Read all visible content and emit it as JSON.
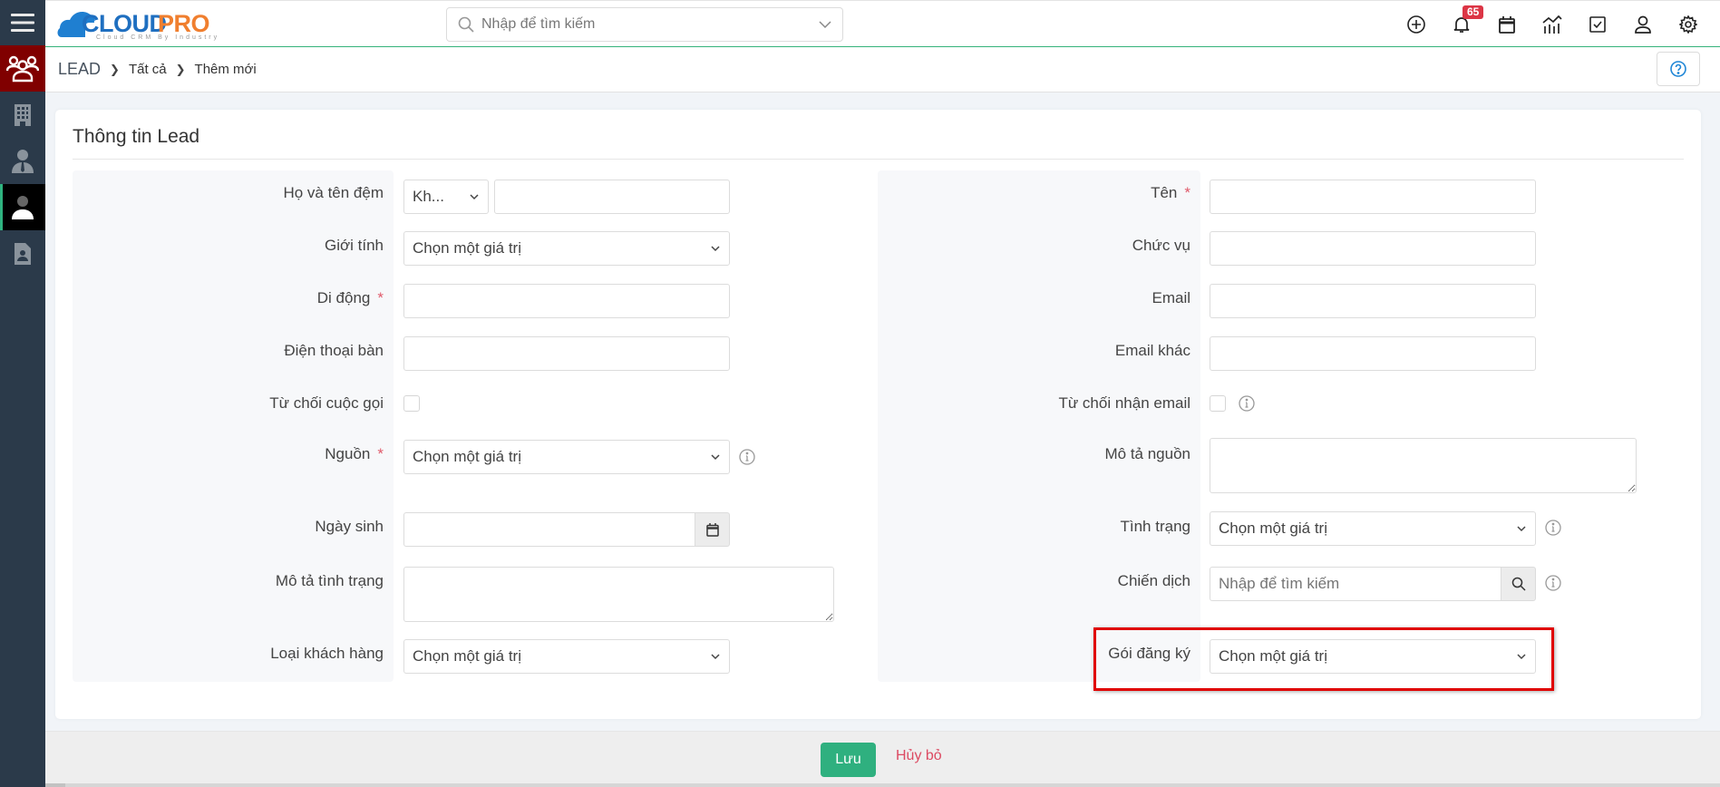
{
  "header": {
    "logo_text_main": "CLOUD",
    "logo_text_accent": "PRO",
    "logo_tagline": "Cloud CRM By Industry",
    "search_placeholder": "Nhập để tìm kiếm",
    "notification_count": "65",
    "icons": [
      "plus-circle-icon",
      "bell-icon",
      "calendar-icon",
      "chart-icon",
      "checkbox-icon",
      "user-icon",
      "gear-icon"
    ]
  },
  "sidebar": {
    "items": [
      {
        "name": "leads",
        "icon": "people-group-icon"
      },
      {
        "name": "organizations",
        "icon": "building-icon"
      },
      {
        "name": "contacts",
        "icon": "businessman-icon"
      },
      {
        "name": "leads-active",
        "icon": "person-icon"
      },
      {
        "name": "contact-card",
        "icon": "contact-card-icon"
      }
    ]
  },
  "breadcrumb": {
    "root": "LEAD",
    "items": [
      "Tất cả",
      "Thêm mới"
    ]
  },
  "card": {
    "title": "Thông tin Lead"
  },
  "form": {
    "left": {
      "full_name_label": "Họ và tên đệm",
      "salutation_value": "Kh...",
      "full_name_value": "",
      "gender_label": "Giới tính",
      "gender_value": "Chọn một giá trị",
      "mobile_label": "Di động",
      "mobile_value": "",
      "phone_label": "Điện thoại bàn",
      "phone_value": "",
      "reject_call_label": "Từ chối cuộc gọi",
      "source_label": "Nguồn",
      "source_value": "Chọn một giá trị",
      "birthday_label": "Ngày sinh",
      "birthday_value": "",
      "status_desc_label": "Mô tả tình trạng",
      "customer_type_label": "Loại khách hàng",
      "customer_type_value": "Chọn một giá trị"
    },
    "right": {
      "first_name_label": "Tên",
      "first_name_value": "",
      "title_label": "Chức vụ",
      "title_value": "",
      "email_label": "Email",
      "email_value": "",
      "email_other_label": "Email khác",
      "email_other_value": "",
      "reject_email_label": "Từ chối nhận email",
      "source_desc_label": "Mô tả nguồn",
      "status_label": "Tình trạng",
      "status_value": "Chọn một giá trị",
      "campaign_label": "Chiến dịch",
      "campaign_placeholder": "Nhập để tìm kiếm",
      "package_label": "Gói đăng ký",
      "package_value": "Chọn một giá trị"
    },
    "required_mark": "*"
  },
  "footer": {
    "save_label": "Lưu",
    "cancel_label": "Hủy bỏ"
  },
  "colors": {
    "sidebar_bg": "#2b3a4a",
    "leads_module": "#800000",
    "accent_green": "#2fb07f",
    "danger": "#dc4a62",
    "highlight_red": "#e00000",
    "logo_blue": "#1f7fd1",
    "logo_orange": "#f07f2f"
  }
}
